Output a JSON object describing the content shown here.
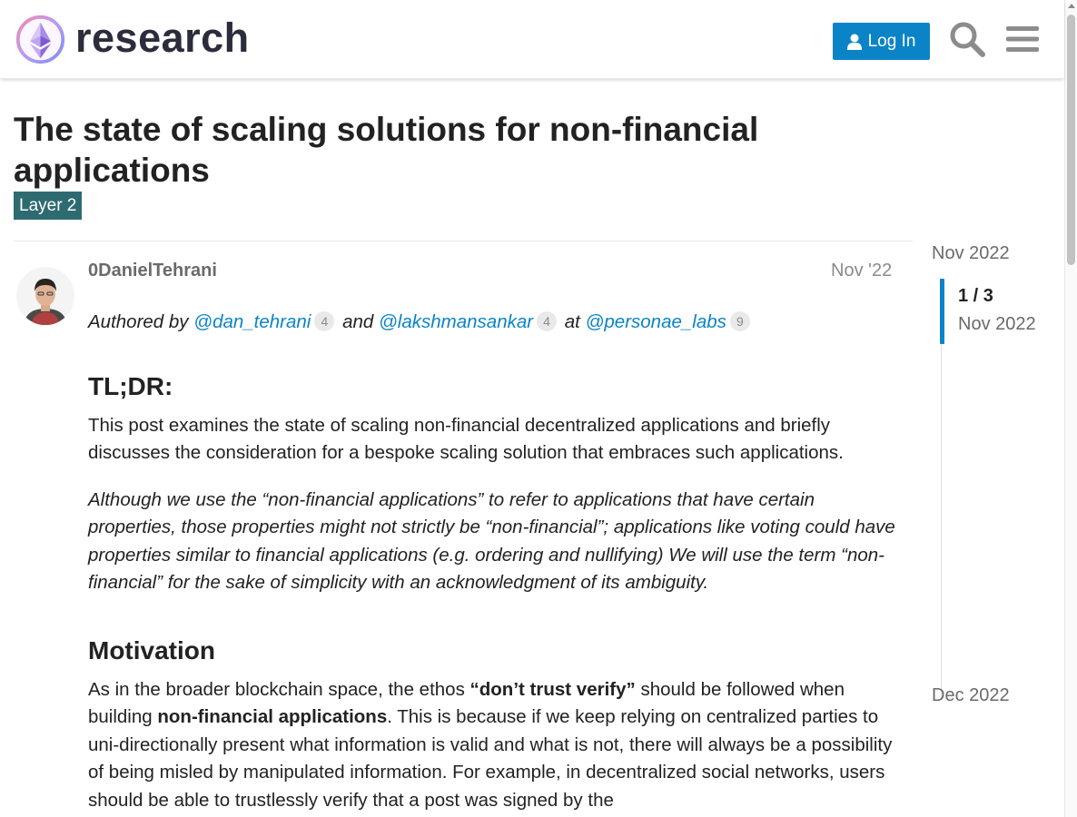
{
  "header": {
    "logo_text": "research",
    "login_label": "Log In",
    "search_icon": "search-icon",
    "menu_icon": "hamburger-menu-icon"
  },
  "topic": {
    "title": "The state of scaling solutions for non-financial applications",
    "category": "Layer 2"
  },
  "post": {
    "username": "0DanielTehrani",
    "date": "Nov '22",
    "authored_prefix": "Authored by",
    "mention1": "@dan_tehrani",
    "mention1_count": "4",
    "and_word": "and",
    "mention2": "@lakshmansankar",
    "mention2_count": "4",
    "at_word": "at",
    "mention3": "@personae_labs",
    "mention3_count": "9",
    "h_tldr": "TL;DR:",
    "p_tldr": "This post examines the state of scaling non-financial decentralized applications and briefly discusses the consideration for a bespoke scaling solution that embraces such applications.",
    "p_italic": "Although we use the “non-financial applications” to refer to applications that have certain properties, those properties might not strictly be “non-financial”; applications like voting could have properties similar to financial applications (e.g. ordering and nullifying) We will use the term “non-financial” for the sake of simplicity with an acknowledgment of its ambiguity.",
    "h_motivation": "Motivation",
    "motivation_1": "As in the broader blockchain space, the ethos ",
    "motivation_bold1": "“don’t trust verify”",
    "motivation_2": " should be followed when building ",
    "motivation_bold2": "non-financial applications",
    "motivation_3": ". This is because if we keep relying on centralized parties to uni-directionally present what information is valid and what is not, there will always be a possibility of being misled by manipulated information. For example, in decentralized social networks, users should be able to trustlessly verify that a post was signed by the"
  },
  "timeline": {
    "start_date": "Nov 2022",
    "position": "1 / 3",
    "position_date": "Nov 2022",
    "end_date": "Dec 2022",
    "progress_fraction": 0.33
  },
  "colors": {
    "accent": "#0a84c7",
    "category": "#2e6b70"
  }
}
